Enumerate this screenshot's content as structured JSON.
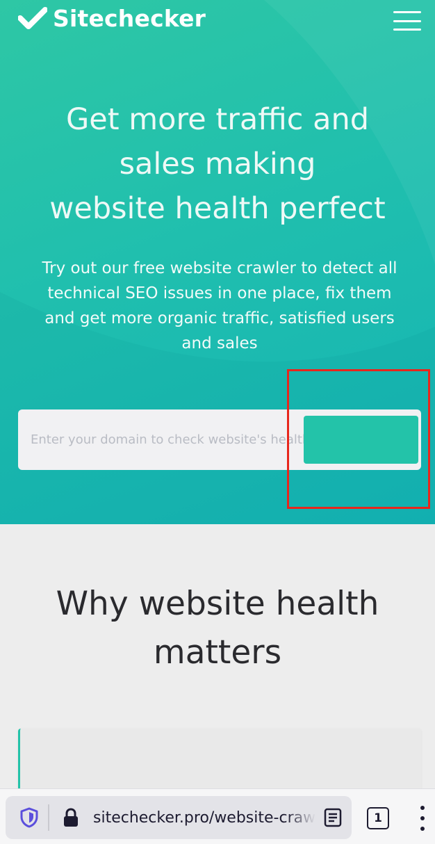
{
  "header": {
    "logo_text": "Sitechecker",
    "menu_icon": "hamburger-icon"
  },
  "hero": {
    "title_lines": [
      "Get more traffic and",
      "sales making",
      "website health perfect"
    ],
    "subtitle_lines": [
      "Try out our free website crawler to detect all",
      "technical SEO issues in one place, fix them",
      "and get more organic traffic, satisfied users",
      "and sales"
    ],
    "search_placeholder": "Enter your domain to check website's health",
    "check_button_label": ""
  },
  "section_why": {
    "title_lines": [
      "Why website health",
      "matters"
    ]
  },
  "browser": {
    "url": "sitechecker.pro/website-crawler/",
    "tab_count": "1",
    "shield_icon": "shield-icon",
    "lock_icon": "lock-icon",
    "reader_icon": "reader-mode-icon"
  },
  "colors": {
    "brand_green": "#23c3a9",
    "hero_gradient_start": "#2ec7a5",
    "hero_gradient_end": "#14b3b4",
    "highlight": "#e8261c"
  }
}
